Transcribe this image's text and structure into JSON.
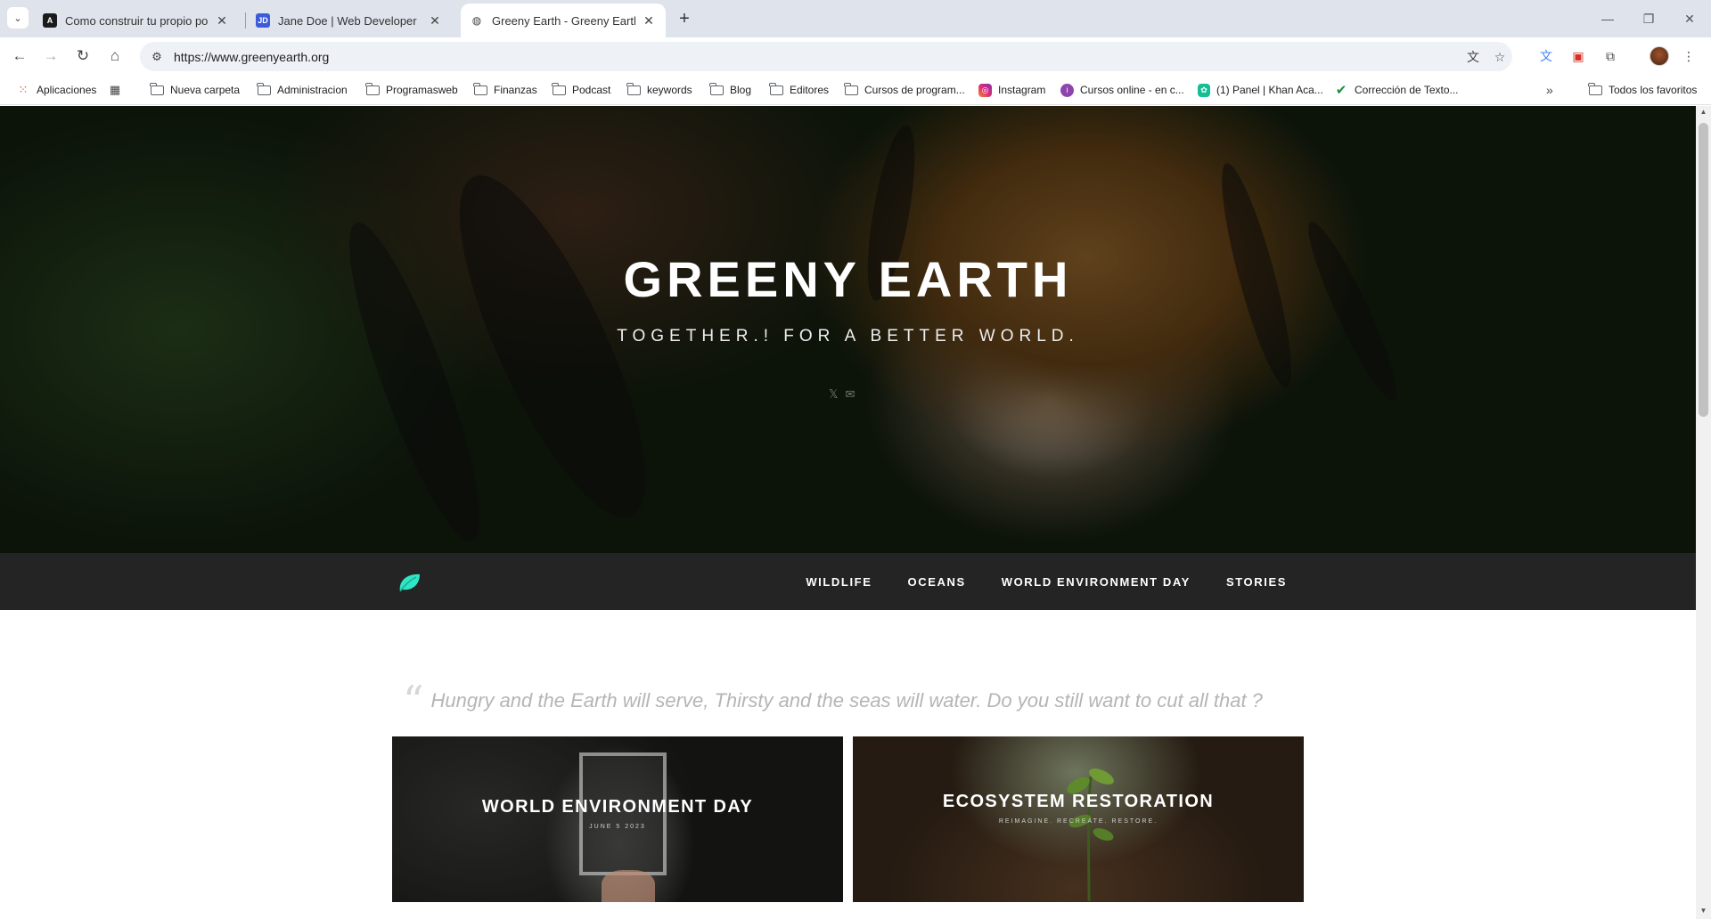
{
  "browser": {
    "tabs": [
      {
        "title": "Como construir tu propio porta",
        "favicon": "A",
        "favicon_bg": "#1b1b1b",
        "active": false
      },
      {
        "title": "Jane Doe | Web Developer",
        "favicon": "JD",
        "favicon_bg": "#3b5bdb",
        "active": false
      },
      {
        "title": "Greeny Earth - Greeny Earth - T",
        "favicon": "globe",
        "favicon_bg": "#ffffff",
        "active": true
      }
    ],
    "url": "https://www.greenyearth.org",
    "bookmarks": [
      {
        "label": "Aplicaciones",
        "icon": "apps-grid-icon"
      },
      {
        "label": "",
        "icon": "app-grid-icon"
      },
      {
        "label": "Nueva carpeta",
        "icon": "folder-icon"
      },
      {
        "label": "Administracion",
        "icon": "folder-icon"
      },
      {
        "label": "Programasweb",
        "icon": "folder-icon"
      },
      {
        "label": "Finanzas",
        "icon": "folder-icon"
      },
      {
        "label": "Podcast",
        "icon": "folder-icon"
      },
      {
        "label": "keywords",
        "icon": "folder-icon"
      },
      {
        "label": "Blog",
        "icon": "folder-icon"
      },
      {
        "label": "Editores",
        "icon": "folder-icon"
      },
      {
        "label": "Cursos de program...",
        "icon": "folder-icon"
      },
      {
        "label": "Instagram",
        "icon": "instagram-icon"
      },
      {
        "label": "Cursos online - en c...",
        "icon": "course-icon"
      },
      {
        "label": "(1) Panel | Khan Aca...",
        "icon": "khan-icon"
      },
      {
        "label": "Corrección de Texto...",
        "icon": "check-icon"
      }
    ],
    "all_bookmarks": "Todos los favoritos"
  },
  "hero": {
    "title": "GREENY EARTH",
    "subtitle": "TOGETHER.! FOR A BETTER WORLD."
  },
  "nav": {
    "links": [
      "WILDLIFE",
      "OCEANS",
      "WORLD ENVIRONMENT DAY",
      "STORIES"
    ],
    "logo_color": "#2ee6c5"
  },
  "quote": "Hungry and the Earth will serve, Thirsty and the seas will water. Do you still want to cut all that ?",
  "cards": [
    {
      "title": "WORLD ENVIRONMENT DAY",
      "date": "JUNE 5 2023"
    },
    {
      "title": "ECOSYSTEM RESTORATION",
      "date": "REIMAGINE. RECREATE. RESTORE."
    }
  ]
}
